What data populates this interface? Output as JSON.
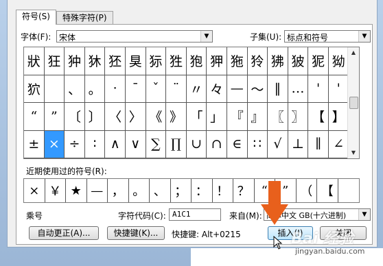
{
  "tabs": [
    {
      "label": "符号(S)",
      "active": true
    },
    {
      "label": "特殊字符(P)",
      "active": false
    }
  ],
  "font_row": {
    "label": "字体(F):",
    "value": "宋体"
  },
  "subset_row": {
    "label": "子集(U):",
    "value": "标点和符号"
  },
  "grid_rows": [
    [
      "狀",
      "狂",
      "狆",
      "狇",
      "狉",
      "狊",
      "狋",
      "狌",
      "狍",
      "狎",
      "狏",
      "狑",
      "狒",
      "狓",
      "狔",
      "狕"
    ],
    [
      "狖",
      "",
      "、",
      "。",
      "·",
      "ˉ",
      "ˇ",
      "¨",
      "〃",
      "々",
      "—",
      "～",
      "‖",
      "…",
      "'",
      "'"
    ],
    [
      "“",
      "”",
      "〔",
      "〕",
      "〈",
      "〉",
      "《",
      "》",
      "「",
      "」",
      "『",
      "』",
      "〖",
      "〗",
      "【",
      "】"
    ],
    [
      "±",
      "×",
      "÷",
      "∶",
      "∧",
      "∨",
      "∑",
      "∏",
      "∪",
      "∩",
      "∈",
      "∷",
      "√",
      "⊥",
      "∥",
      "∠"
    ]
  ],
  "selected_cell": {
    "row": 3,
    "col": 1
  },
  "recent_label": "近期使用过的符号(R):",
  "recent_symbols": [
    "×",
    "￥",
    "★",
    "—",
    "，",
    "。",
    "、",
    "；",
    "：",
    "！",
    "？",
    "“",
    "”",
    "（",
    "【",
    ""
  ],
  "char_name": "乘号",
  "charcode": {
    "label": "字符代码(C):",
    "value": "A1C1"
  },
  "from": {
    "label": "来自(M):",
    "value": "简体中文 GB(十六进制)"
  },
  "buttons": {
    "autocorrect": "自动更正(A)...",
    "shortcut_key": "快捷键(K)...",
    "insert": "插入(I)",
    "close": "关闭"
  },
  "shortcut_text": "快捷键: Alt+0215",
  "watermark": {
    "brand": "Bai 经验",
    "url": "jingyan.baidu.com"
  },
  "colors": {
    "selection": "#3399ff",
    "arrow": "#e8601c"
  }
}
